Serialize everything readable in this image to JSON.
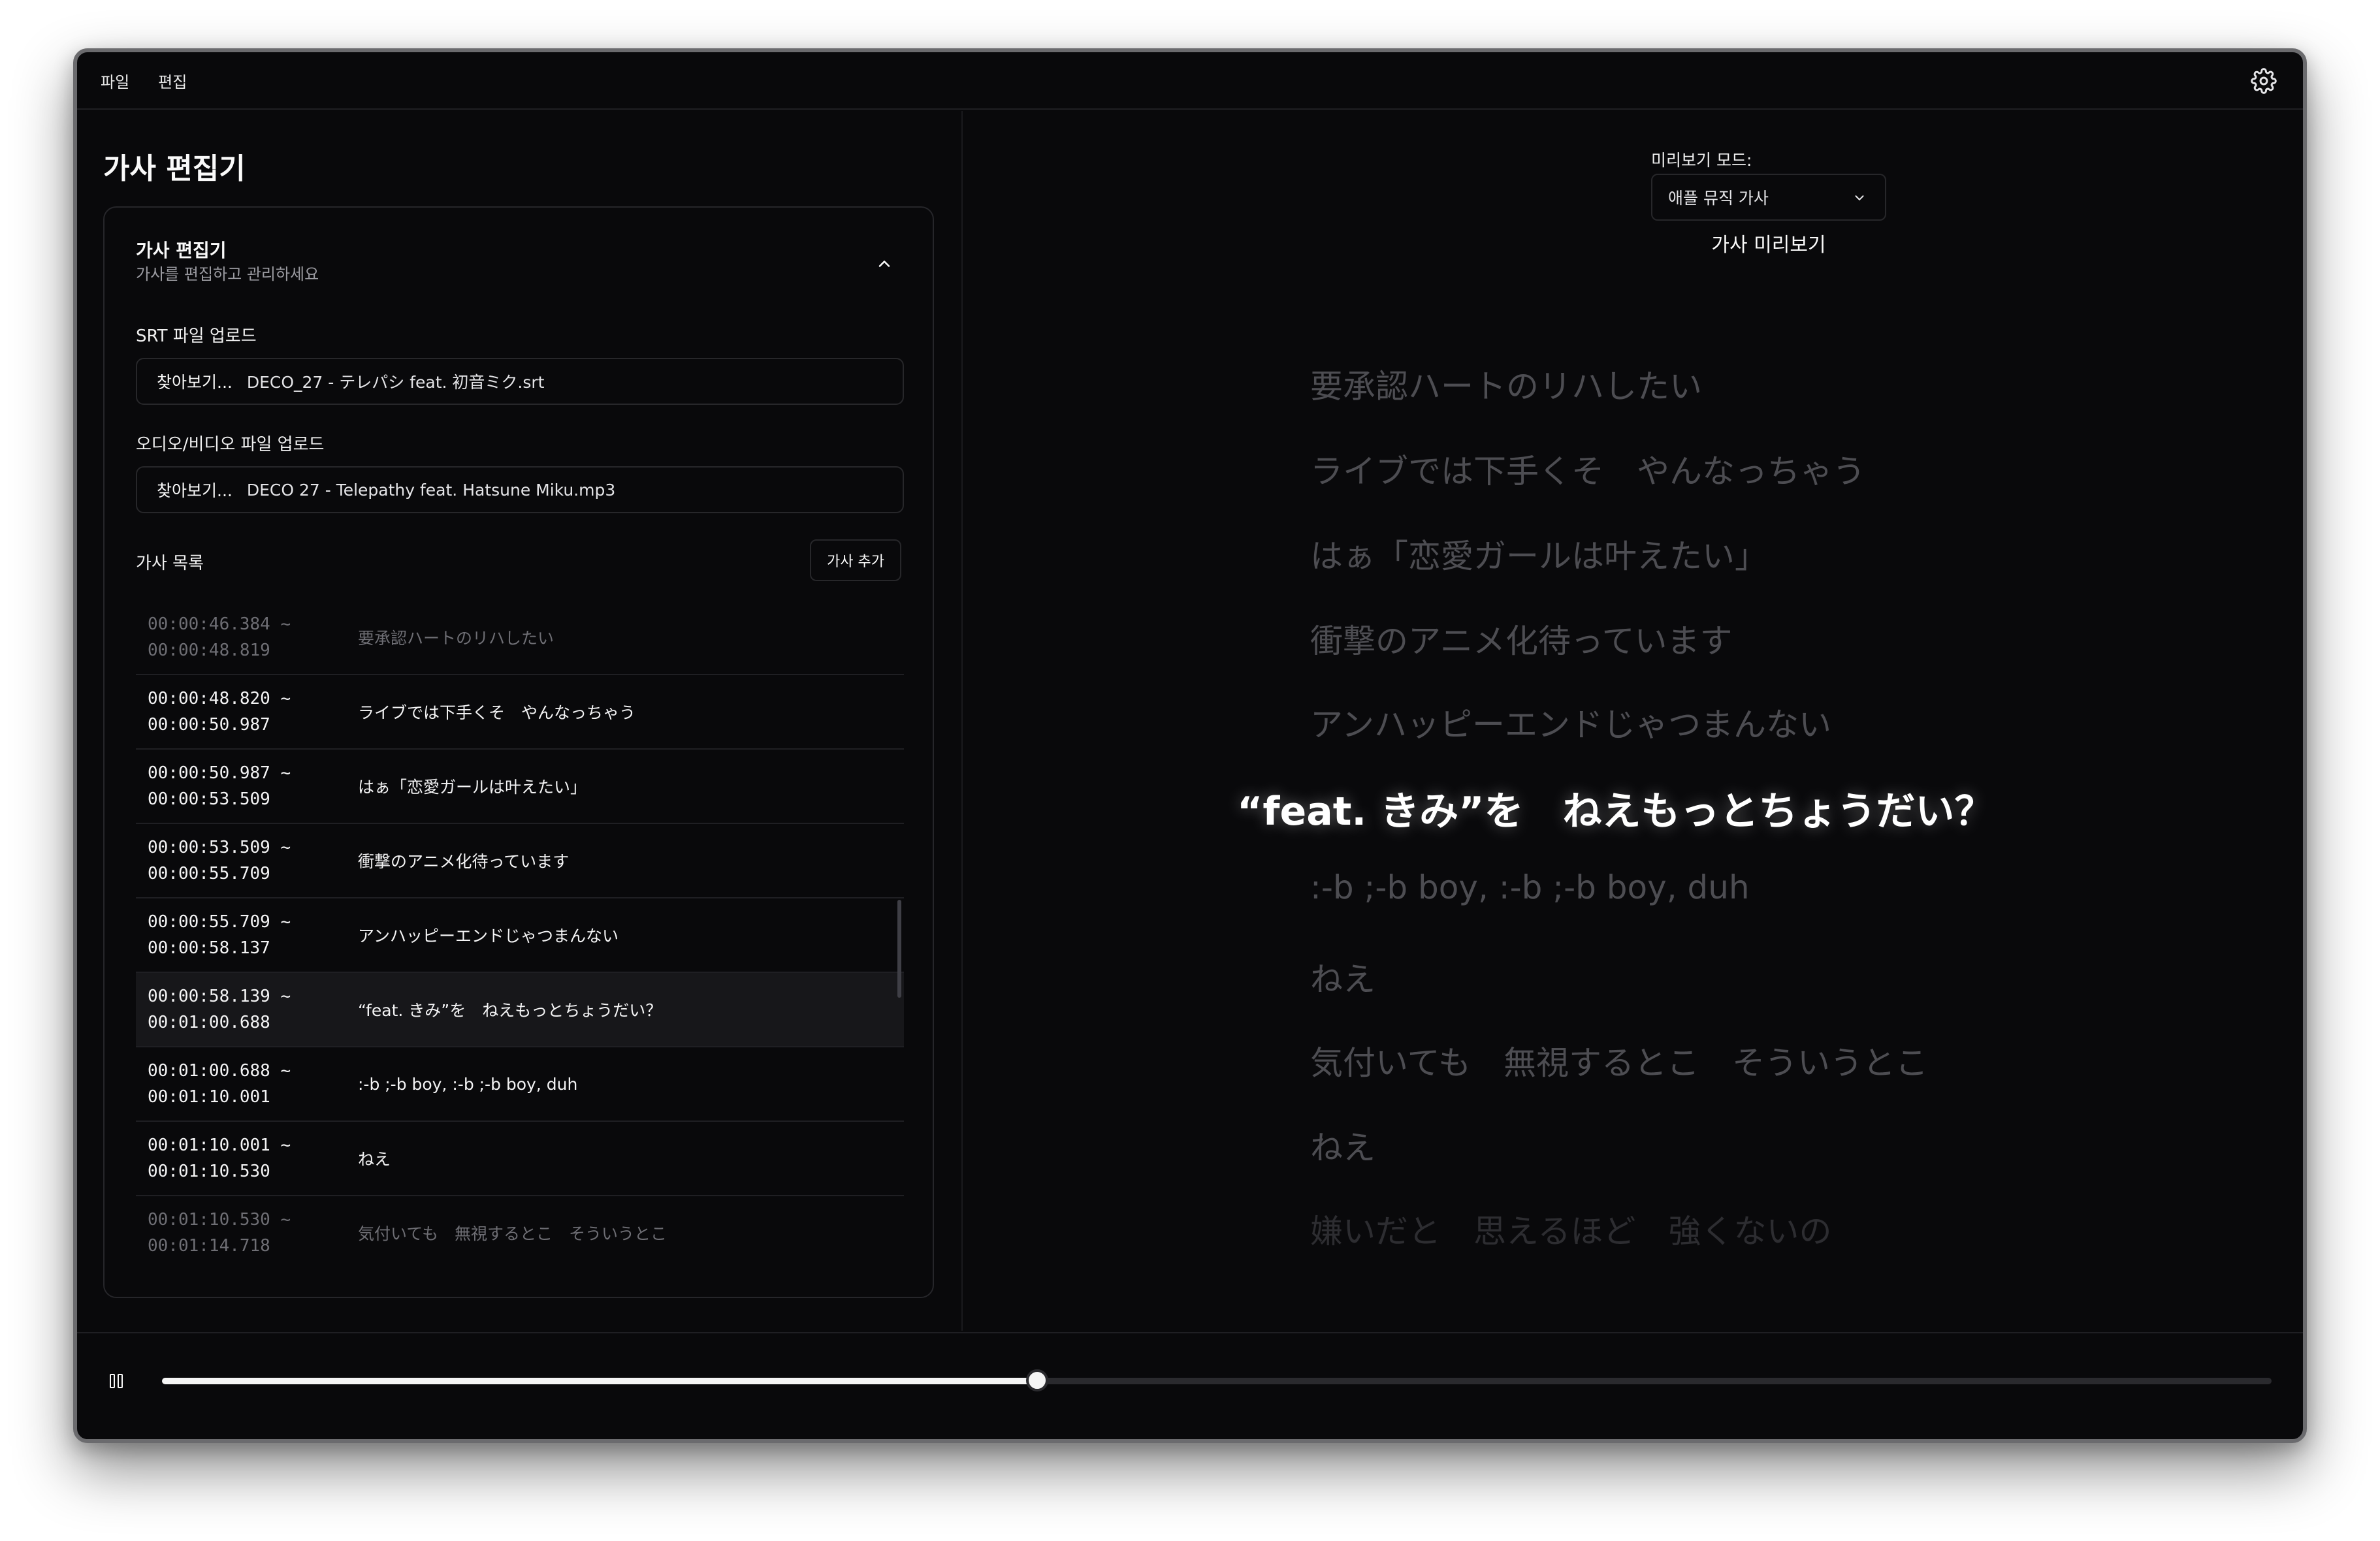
{
  "menubar": {
    "items": [
      "파일",
      "편집"
    ],
    "settings_icon": "gear-icon"
  },
  "editor": {
    "page_title": "가사 편집기",
    "card_title": "가사 편집기",
    "card_subtitle": "가사를 편집하고 관리하세요",
    "srt_label": "SRT 파일 업로드",
    "srt_browse": "찾아보기...",
    "srt_file": "DECO_27 - テレパシ feat. 初音ミク.srt",
    "media_label": "오디오/비디오 파일 업로드",
    "media_browse": "찾아보기...",
    "media_file": "DECO 27 - Telepathy feat. Hatsune Miku.mp3",
    "list_label": "가사 목록",
    "add_button": "가사 추가",
    "rows": [
      {
        "time": "00:00:46.384 ~\n00:00:48.819",
        "text": "要承認ハートのリハしたい"
      },
      {
        "time": "00:00:48.820 ~\n00:00:50.987",
        "text": "ライブでは下手くそ　やんなっちゃう"
      },
      {
        "time": "00:00:50.987 ~\n00:00:53.509",
        "text": "はぁ「恋愛ガールは叶えたい」"
      },
      {
        "time": "00:00:53.509 ~\n00:00:55.709",
        "text": "衝撃のアニメ化待っています"
      },
      {
        "time": "00:00:55.709 ~\n00:00:58.137",
        "text": "アンハッピーエンドじゃつまんない"
      },
      {
        "time": "00:00:58.139 ~\n00:01:00.688",
        "text": "“feat. きみ”を　ねえもっとちょうだい？"
      },
      {
        "time": "00:01:00.688 ~\n00:01:10.001",
        "text": ":-b ;-b boy, :-b ;-b boy, duh"
      },
      {
        "time": "00:01:10.001 ~\n00:01:10.530",
        "text": "ねえ"
      },
      {
        "time": "00:01:10.530 ~\n00:01:14.718",
        "text": "気付いても　無視するとこ　そういうとこ"
      }
    ]
  },
  "preview": {
    "mode_label": "미리보기 모드:",
    "mode_value": "애플 뮤직 가사",
    "title": "가사 미리보기",
    "lines": [
      "要承認ハートのリハしたい",
      "ライブでは下手くそ　やんなっちゃう",
      "はぁ「恋愛ガールは叶えたい」",
      "衝撃のアニメ化待っています",
      "アンハッピーエンドじゃつまんない",
      "“feat. きみ”を　ねえもっとちょうだい？",
      ":-b ;-b boy, :-b ;-b boy, duh",
      "ねえ",
      "気付いても　無視するとこ　そういうとこ",
      "ねえ",
      "嫌いだと　思えるほど　強くないの"
    ],
    "current_index": 5
  },
  "player": {
    "state": "playing",
    "progress": 0.415
  },
  "colors": {
    "background": "#09090b",
    "border": "#27272a",
    "text": "#fafafa",
    "muted_lyric": "#4d4d52"
  }
}
